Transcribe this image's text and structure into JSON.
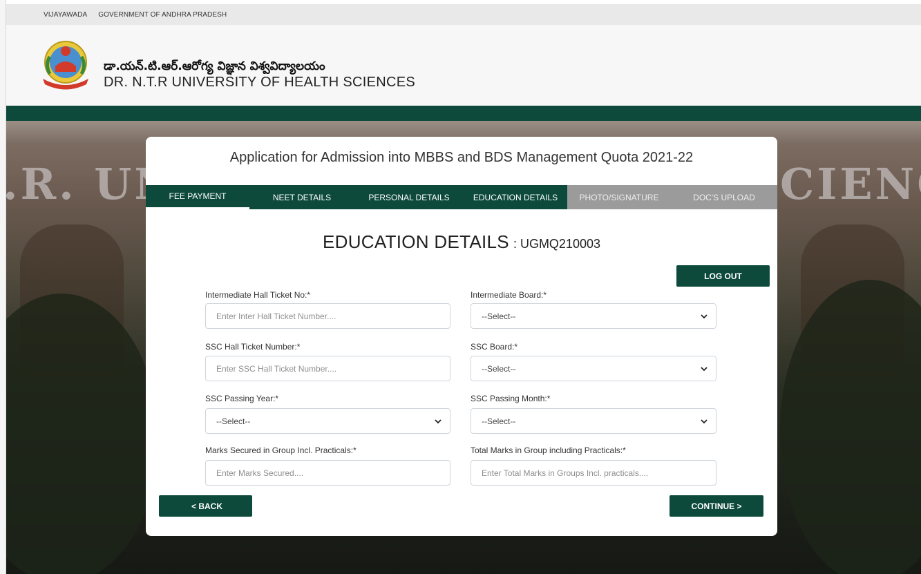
{
  "topbar": {
    "city": "VIJAYAWADA",
    "govt": "GOVERNMENT OF ANDHRA PRADESH"
  },
  "header": {
    "title_telugu": "డా.యన్.టి.ఆర్.ఆరోగ్య విజ్ఞాన విశ్వవిద్యాలయం",
    "title_english": "DR. N.T.R UNIVERSITY OF HEALTH SCIENCES"
  },
  "background": {
    "sign_left": ".R. UN",
    "sign_right": "CIENC"
  },
  "page": {
    "title": "Application for Admission into MBBS and BDS Management Quota 2021-22"
  },
  "tabs": [
    {
      "label": "FEE PAYMENT"
    },
    {
      "label": "NEET DETAILS"
    },
    {
      "label": "PERSONAL DETAILS"
    },
    {
      "label": "EDUCATION DETAILS"
    },
    {
      "label": "PHOTO/SIGNATURE"
    },
    {
      "label": "DOC'S UPLOAD"
    }
  ],
  "section": {
    "title": "EDUCATION DETAILS",
    "code": ": UGMQ210003"
  },
  "logout_label": "LOG OUT",
  "form": {
    "inter_hall_ticket": {
      "label": "Intermediate Hall Ticket No:*",
      "placeholder": "Enter Inter Hall Ticket Number...."
    },
    "inter_board": {
      "label": "Intermediate Board:*",
      "value": "--Select--"
    },
    "ssc_hall_ticket": {
      "label": "SSC Hall Ticket Number:*",
      "placeholder": "Enter SSC Hall Ticket Number...."
    },
    "ssc_board": {
      "label": "SSC Board:*",
      "value": "--Select--"
    },
    "ssc_year": {
      "label": "SSC Passing Year:*",
      "value": "--Select--"
    },
    "ssc_month": {
      "label": "SSC Passing Month:*",
      "value": "--Select--"
    },
    "marks_secured": {
      "label": "Marks Secured in Group Incl. Practicals:*",
      "placeholder": "Enter Marks Secured...."
    },
    "total_marks": {
      "label": "Total Marks in Group including Practicals:*",
      "placeholder": "Enter Total Marks in Groups Incl. practicals...."
    }
  },
  "nav": {
    "back": "< BACK",
    "continue": "CONTINUE >"
  },
  "colors": {
    "primary": "#0d4a3c",
    "disabled_tab": "#9b9b9b"
  }
}
